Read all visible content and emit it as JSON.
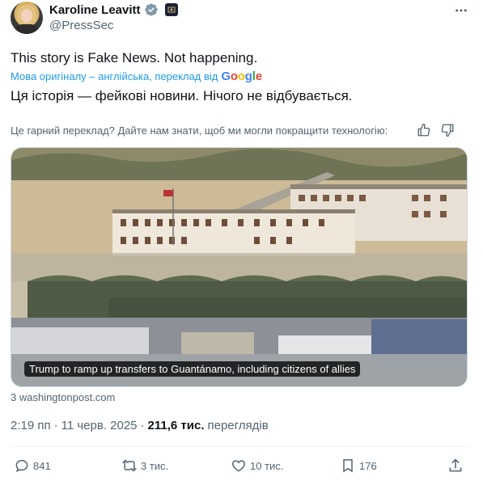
{
  "author": {
    "name": "Karoline Leavitt",
    "handle": "@PressSec"
  },
  "tweet": {
    "text": "This story is Fake News. Not happening.",
    "translation_label": "Мова оригіналу – англійська, переклад від",
    "translation_provider": "Google",
    "translated_text": "Ця історія — фейкові новини. Нічого не відбувається.",
    "feedback_prompt": "Це гарний переклад? Дайте нам знати, щоб ми могли покращити технологію:"
  },
  "media": {
    "caption": "Trump to ramp up transfers to Guantánamo, including citizens of allies",
    "source": "3 washingtonpost.com"
  },
  "meta": {
    "time": "2:19 пп",
    "separator": "·",
    "date": "11 черв. 2025",
    "views_count": "211,6 тис.",
    "views_label": "переглядів"
  },
  "actions": {
    "replies": "841",
    "reposts": "3 тис.",
    "likes": "10 тис.",
    "bookmarks": "176"
  },
  "colors": {
    "accent": "#1d9bf0",
    "verified": "#829aab",
    "muted": "#536471"
  }
}
